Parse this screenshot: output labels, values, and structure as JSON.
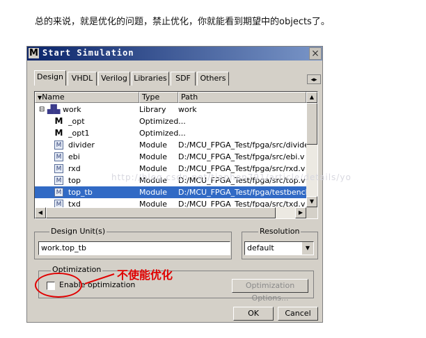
{
  "caption": "总的来说，就是优化的问题，禁止优化，你就能看到期望中的objects了。",
  "window": {
    "title": "Start Simulation",
    "logo": "M",
    "close": "×"
  },
  "tabs": [
    "Design",
    "VHDL",
    "Verilog",
    "Libraries",
    "SDF",
    "Others"
  ],
  "tab_scroll": "◂▸",
  "list": {
    "columns": [
      "Name",
      "Type",
      "Path"
    ],
    "rows": [
      {
        "name": "work",
        "type": "Library",
        "path": "work",
        "icon": "library-icon",
        "expander": "⊟",
        "selected": false
      },
      {
        "name": "_opt",
        "type": "Optimized...",
        "path": "",
        "icon": "optimized-icon",
        "selected": false
      },
      {
        "name": "_opt1",
        "type": "Optimized...",
        "path": "",
        "icon": "optimized-icon",
        "selected": false
      },
      {
        "name": "divider",
        "type": "Module",
        "path": "D:/MCU_FPGA_Test/fpga/src/divide",
        "icon": "module-icon",
        "selected": false
      },
      {
        "name": "ebi",
        "type": "Module",
        "path": "D:/MCU_FPGA_Test/fpga/src/ebi.v",
        "icon": "module-icon",
        "selected": false
      },
      {
        "name": "rxd",
        "type": "Module",
        "path": "D:/MCU_FPGA_Test/fpga/src/rxd.v",
        "icon": "module-icon",
        "selected": false
      },
      {
        "name": "top",
        "type": "Module",
        "path": "D:/MCU_FPGA_Test/fpga/src/top.v",
        "icon": "module-icon",
        "selected": false
      },
      {
        "name": "top_tb",
        "type": "Module",
        "path": "D:/MCU_FPGA_Test/fpga/testbench",
        "icon": "module-icon",
        "selected": true
      },
      {
        "name": "txd",
        "type": "Module",
        "path": "D:/MCU_FPGA_Test/fpga/src/txd.v",
        "icon": "module-icon",
        "selected": false
      }
    ]
  },
  "design_unit": {
    "label": "Design Unit(s)",
    "value": "work.top_tb"
  },
  "resolution": {
    "label": "Resolution",
    "value": "default"
  },
  "optimization": {
    "label": "Optimization",
    "checkbox_label": "Enable optimization",
    "checked": false,
    "options_button": "Optimization Options..."
  },
  "buttons": {
    "ok": "OK",
    "cancel": "Cancel"
  },
  "annotation": {
    "text": "不使能优化",
    "color": "#e00000"
  },
  "watermark": "http://blog.csdn.net/tianhen791/article/details/yo",
  "colors": {
    "titlebar": "#0a246a",
    "selection": "#316ac5",
    "dialog": "#d4d0c8"
  }
}
